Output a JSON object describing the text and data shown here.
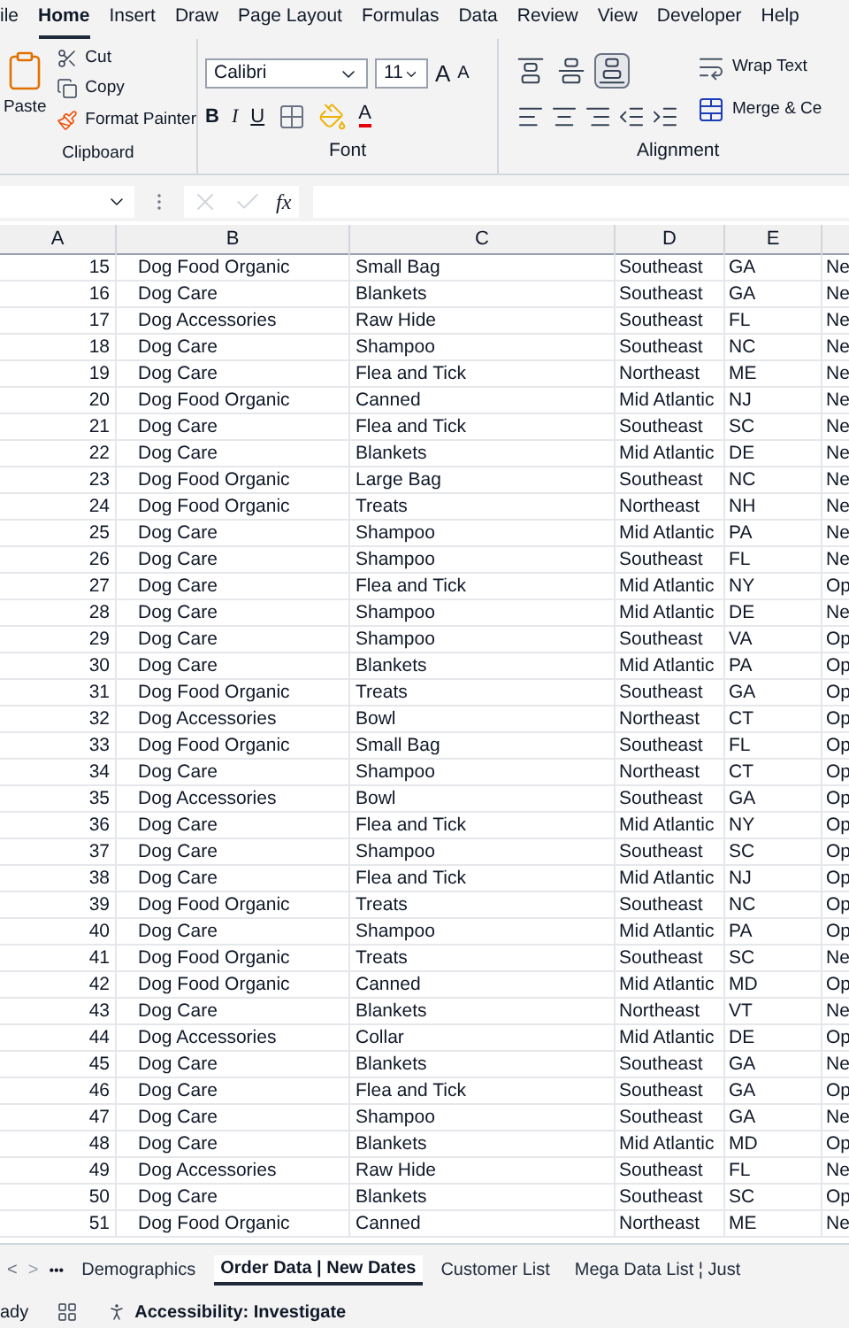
{
  "menu_tabs": [
    {
      "label": "ile",
      "selected": false
    },
    {
      "label": "Home",
      "selected": true
    },
    {
      "label": "Insert",
      "selected": false
    },
    {
      "label": "Draw",
      "selected": false
    },
    {
      "label": "Page Layout",
      "selected": false
    },
    {
      "label": "Formulas",
      "selected": false
    },
    {
      "label": "Data",
      "selected": false
    },
    {
      "label": "Review",
      "selected": false
    },
    {
      "label": "View",
      "selected": false
    },
    {
      "label": "Developer",
      "selected": false
    },
    {
      "label": "Help",
      "selected": false
    }
  ],
  "clipboard": {
    "paste": "Paste",
    "cut": "Cut",
    "copy": "Copy",
    "format_painter": "Format Painter",
    "label": "Clipboard"
  },
  "font": {
    "name": "Calibri",
    "size": "11",
    "grow": "A",
    "shrink": "A",
    "bold": "B",
    "italic": "I",
    "underline": "U",
    "font_color": "A",
    "label": "Font"
  },
  "alignment": {
    "vertical": [
      {
        "kind": "top",
        "selected": false
      },
      {
        "kind": "middle",
        "selected": false
      },
      {
        "kind": "bottom",
        "selected": true
      }
    ],
    "wrap_text": "Wrap Text",
    "merge": "Merge & Ce",
    "label": "Alignment"
  },
  "formula_bar": {
    "fx": "fx"
  },
  "columns": [
    "A",
    "B",
    "C",
    "D",
    "E"
  ],
  "rows": [
    {
      "n": "15",
      "b": "Dog Food Organic",
      "c": "Small Bag",
      "d": "Southeast",
      "e": "GA",
      "f": "Ne"
    },
    {
      "n": "16",
      "b": "Dog Care",
      "c": "Blankets",
      "d": "Southeast",
      "e": "GA",
      "f": "Ne"
    },
    {
      "n": "17",
      "b": "Dog Accessories",
      "c": "Raw Hide",
      "d": "Southeast",
      "e": "FL",
      "f": "Ne"
    },
    {
      "n": "18",
      "b": "Dog Care",
      "c": "Shampoo",
      "d": "Southeast",
      "e": "NC",
      "f": "Ne"
    },
    {
      "n": "19",
      "b": "Dog Care",
      "c": "Flea and Tick",
      "d": "Northeast",
      "e": "ME",
      "f": "Ne"
    },
    {
      "n": "20",
      "b": "Dog Food Organic",
      "c": "Canned",
      "d": "Mid Atlantic",
      "e": "NJ",
      "f": "Ne"
    },
    {
      "n": "21",
      "b": "Dog Care",
      "c": "Flea and Tick",
      "d": "Southeast",
      "e": "SC",
      "f": "Ne"
    },
    {
      "n": "22",
      "b": "Dog Care",
      "c": "Blankets",
      "d": "Mid Atlantic",
      "e": "DE",
      "f": "Ne"
    },
    {
      "n": "23",
      "b": "Dog Food Organic",
      "c": "Large Bag",
      "d": "Southeast",
      "e": "NC",
      "f": "Ne"
    },
    {
      "n": "24",
      "b": "Dog Food Organic",
      "c": "Treats",
      "d": "Northeast",
      "e": "NH",
      "f": "Ne"
    },
    {
      "n": "25",
      "b": "Dog Care",
      "c": "Shampoo",
      "d": "Mid Atlantic",
      "e": "PA",
      "f": "Ne"
    },
    {
      "n": "26",
      "b": "Dog Care",
      "c": "Shampoo",
      "d": "Southeast",
      "e": "FL",
      "f": "Ne"
    },
    {
      "n": "27",
      "b": "Dog Care",
      "c": "Flea and Tick",
      "d": "Mid Atlantic",
      "e": "NY",
      "f": "Op"
    },
    {
      "n": "28",
      "b": "Dog Care",
      "c": "Shampoo",
      "d": "Mid Atlantic",
      "e": "DE",
      "f": "Ne"
    },
    {
      "n": "29",
      "b": "Dog Care",
      "c": "Shampoo",
      "d": "Southeast",
      "e": "VA",
      "f": "Op"
    },
    {
      "n": "30",
      "b": "Dog Care",
      "c": "Blankets",
      "d": "Mid Atlantic",
      "e": "PA",
      "f": "Op"
    },
    {
      "n": "31",
      "b": "Dog Food Organic",
      "c": "Treats",
      "d": "Southeast",
      "e": "GA",
      "f": "Op"
    },
    {
      "n": "32",
      "b": "Dog Accessories",
      "c": "Bowl",
      "d": "Northeast",
      "e": "CT",
      "f": "Op"
    },
    {
      "n": "33",
      "b": "Dog Food Organic",
      "c": "Small Bag",
      "d": "Southeast",
      "e": "FL",
      "f": "Op"
    },
    {
      "n": "34",
      "b": "Dog Care",
      "c": "Shampoo",
      "d": "Northeast",
      "e": "CT",
      "f": "Op"
    },
    {
      "n": "35",
      "b": "Dog Accessories",
      "c": "Bowl",
      "d": "Southeast",
      "e": "GA",
      "f": "Op"
    },
    {
      "n": "36",
      "b": "Dog Care",
      "c": "Flea and Tick",
      "d": "Mid Atlantic",
      "e": "NY",
      "f": "Op"
    },
    {
      "n": "37",
      "b": "Dog Care",
      "c": "Shampoo",
      "d": "Southeast",
      "e": "SC",
      "f": "Op"
    },
    {
      "n": "38",
      "b": "Dog Care",
      "c": "Flea and Tick",
      "d": "Mid Atlantic",
      "e": "NJ",
      "f": "Op"
    },
    {
      "n": "39",
      "b": "Dog Food Organic",
      "c": "Treats",
      "d": "Southeast",
      "e": "NC",
      "f": "Op"
    },
    {
      "n": "40",
      "b": "Dog Care",
      "c": "Shampoo",
      "d": "Mid Atlantic",
      "e": "PA",
      "f": "Op"
    },
    {
      "n": "41",
      "b": "Dog Food Organic",
      "c": "Treats",
      "d": "Southeast",
      "e": "SC",
      "f": "Ne"
    },
    {
      "n": "42",
      "b": "Dog Food Organic",
      "c": "Canned",
      "d": "Mid Atlantic",
      "e": "MD",
      "f": "Op"
    },
    {
      "n": "43",
      "b": "Dog Care",
      "c": "Blankets",
      "d": "Northeast",
      "e": "VT",
      "f": "Ne"
    },
    {
      "n": "44",
      "b": "Dog Accessories",
      "c": "Collar",
      "d": "Mid Atlantic",
      "e": "DE",
      "f": "Op"
    },
    {
      "n": "45",
      "b": "Dog Care",
      "c": "Blankets",
      "d": "Southeast",
      "e": "GA",
      "f": "Ne"
    },
    {
      "n": "46",
      "b": "Dog Care",
      "c": "Flea and Tick",
      "d": "Southeast",
      "e": "GA",
      "f": "Op"
    },
    {
      "n": "47",
      "b": "Dog Care",
      "c": "Shampoo",
      "d": "Southeast",
      "e": "GA",
      "f": "Ne"
    },
    {
      "n": "48",
      "b": "Dog Care",
      "c": "Blankets",
      "d": "Mid Atlantic",
      "e": "MD",
      "f": "Op"
    },
    {
      "n": "49",
      "b": "Dog Accessories",
      "c": "Raw Hide",
      "d": "Southeast",
      "e": "FL",
      "f": "Ne"
    },
    {
      "n": "50",
      "b": "Dog Care",
      "c": "Blankets",
      "d": "Southeast",
      "e": "SC",
      "f": "Op"
    },
    {
      "n": "51",
      "b": "Dog Food Organic",
      "c": "Canned",
      "d": "Northeast",
      "e": "ME",
      "f": "Ne"
    }
  ],
  "sheet_nav": {
    "prev": "<",
    "next": ">",
    "more": "•••"
  },
  "sheet_tabs": [
    {
      "label": "Demographics",
      "selected": false
    },
    {
      "label": "Order Data | New Dates",
      "selected": true
    },
    {
      "label": "Customer List",
      "selected": false
    },
    {
      "label": "Mega Data List ¦ Just",
      "selected": false
    }
  ],
  "status_bar": {
    "ready": "ady",
    "accessibility": "Accessibility: Investigate"
  }
}
